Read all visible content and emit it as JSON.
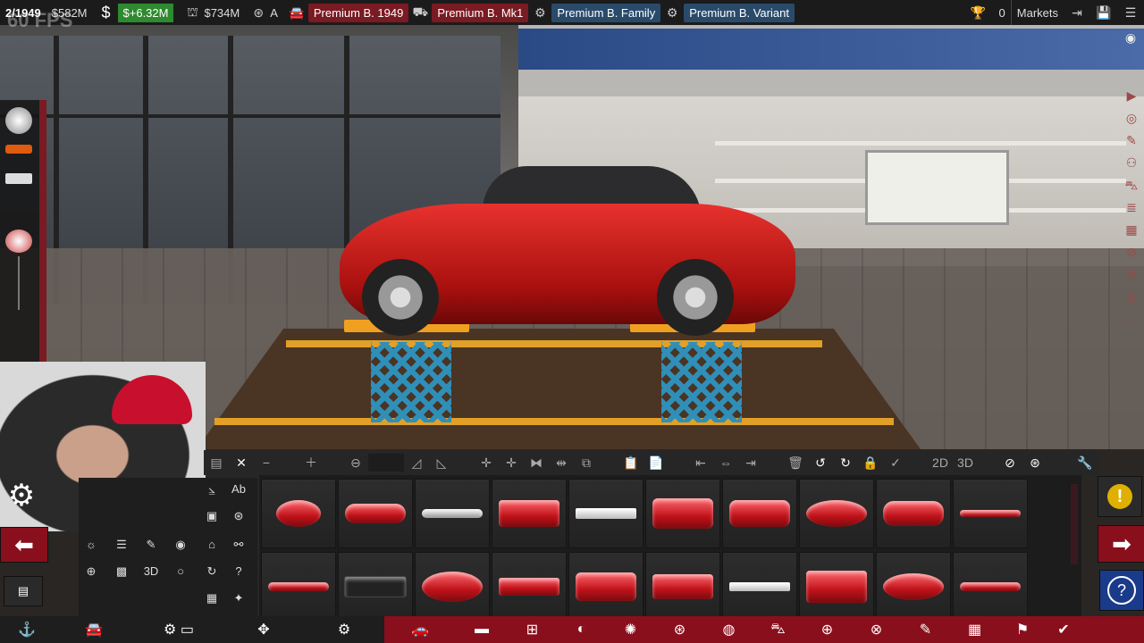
{
  "topbar": {
    "year": "2/1949",
    "balance": "$582M",
    "income": "$+6.32M",
    "expense": "$734M",
    "grade": "A",
    "tabs": [
      {
        "label": "Premium B. 1949"
      },
      {
        "label": "Premium B. Mk1"
      },
      {
        "label": "Premium B. Family"
      },
      {
        "label": "Premium B. Variant"
      }
    ],
    "trophies": "0",
    "markets": "Markets"
  },
  "overlay": {
    "fps": "60 FPS"
  },
  "toolbar": {
    "label_2d": "2D",
    "label_3d": "3D"
  },
  "leftmini": {
    "ab": "Ab",
    "three_d": "3D"
  },
  "colors": {
    "accent_red": "#8a0f1c",
    "topbar_maroon": "#7a1a22",
    "topbar_blue": "#2a4a6a",
    "income_green": "#2e8a2e",
    "warning_yellow": "#e0b000",
    "help_blue": "#1a3a8a"
  },
  "icons": [
    "dollar-icon",
    "bank-icon",
    "steering-icon",
    "car-icon",
    "trophy-icon",
    "export-icon",
    "save-icon",
    "menu-icon",
    "camera-icon",
    "settings-icon",
    "arrow-left-icon",
    "arrow-right-icon",
    "warning-icon",
    "help-icon",
    "wrench-icon"
  ]
}
